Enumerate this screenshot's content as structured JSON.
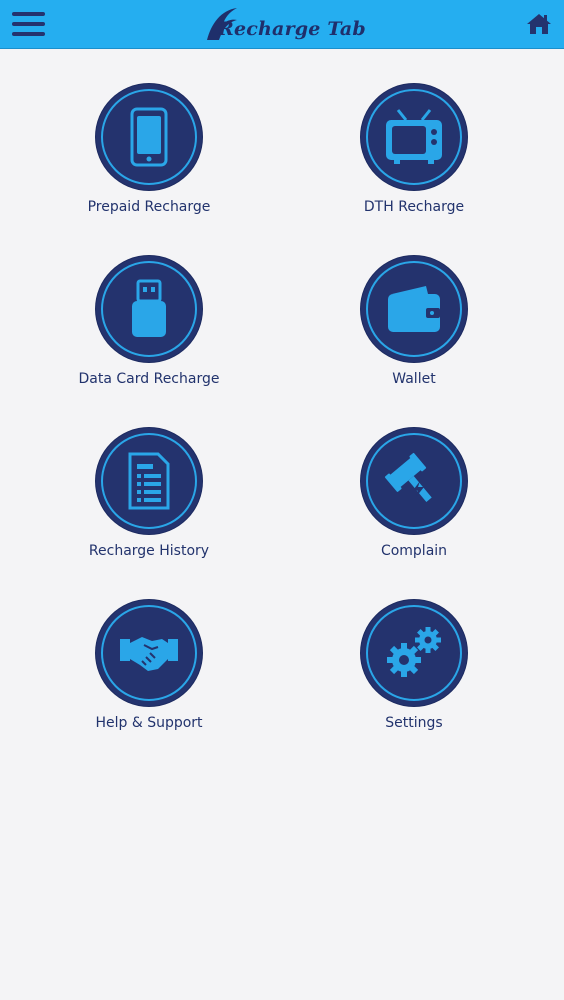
{
  "header": {
    "logo_text": "Recharge Tab",
    "menu_icon": "hamburger-menu-icon",
    "home_icon": "home-icon"
  },
  "tiles": [
    {
      "label": "Prepaid Recharge",
      "icon": "mobile-phone-icon"
    },
    {
      "label": "DTH Recharge",
      "icon": "television-icon"
    },
    {
      "label": "Data Card Recharge",
      "icon": "usb-data-card-icon"
    },
    {
      "label": "Wallet",
      "icon": "wallet-icon"
    },
    {
      "label": "Recharge History",
      "icon": "document-list-icon"
    },
    {
      "label": "Complain",
      "icon": "gavel-icon"
    },
    {
      "label": "Help & Support",
      "icon": "handshake-icon"
    },
    {
      "label": "Settings",
      "icon": "gears-icon"
    }
  ],
  "colors": {
    "header_bg": "#25aef0",
    "circle_bg": "#24336e",
    "icon_color": "#2aa6e8",
    "label_color": "#22336d",
    "page_bg": "#f4f4f6"
  }
}
